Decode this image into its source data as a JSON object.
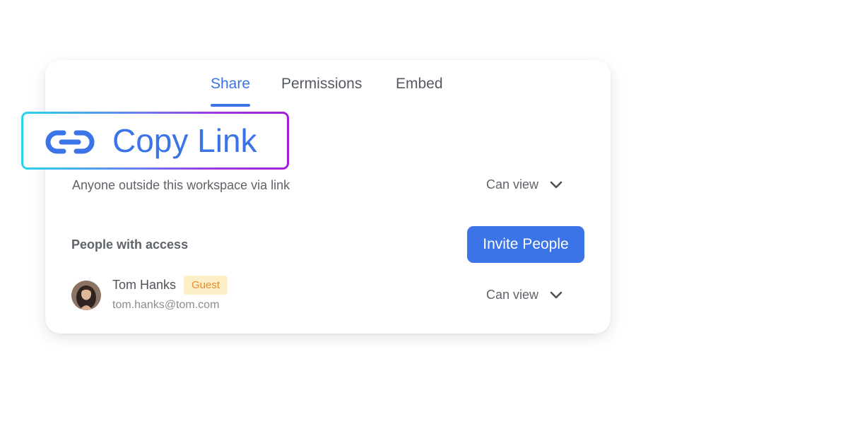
{
  "tabs": [
    {
      "label": "Share",
      "active": true
    },
    {
      "label": "Permissions",
      "active": false
    },
    {
      "label": "Embed",
      "active": false
    }
  ],
  "copy_link": {
    "label": "Copy Link",
    "icon": "link-icon"
  },
  "link_access": {
    "description": "Anyone outside this workspace via link",
    "permission": "Can view"
  },
  "people": {
    "title": "People with access",
    "invite_label": "Invite People",
    "users": [
      {
        "name": "Tom Hanks",
        "badge": "Guest",
        "email": "tom.hanks@tom.com",
        "permission": "Can view"
      }
    ]
  },
  "colors": {
    "accent": "#3a74e6",
    "badge_bg": "#fdf0c9",
    "badge_text": "#e68a2e",
    "highlight_gradient": [
      "#26d6ea",
      "#a61fd8"
    ]
  }
}
